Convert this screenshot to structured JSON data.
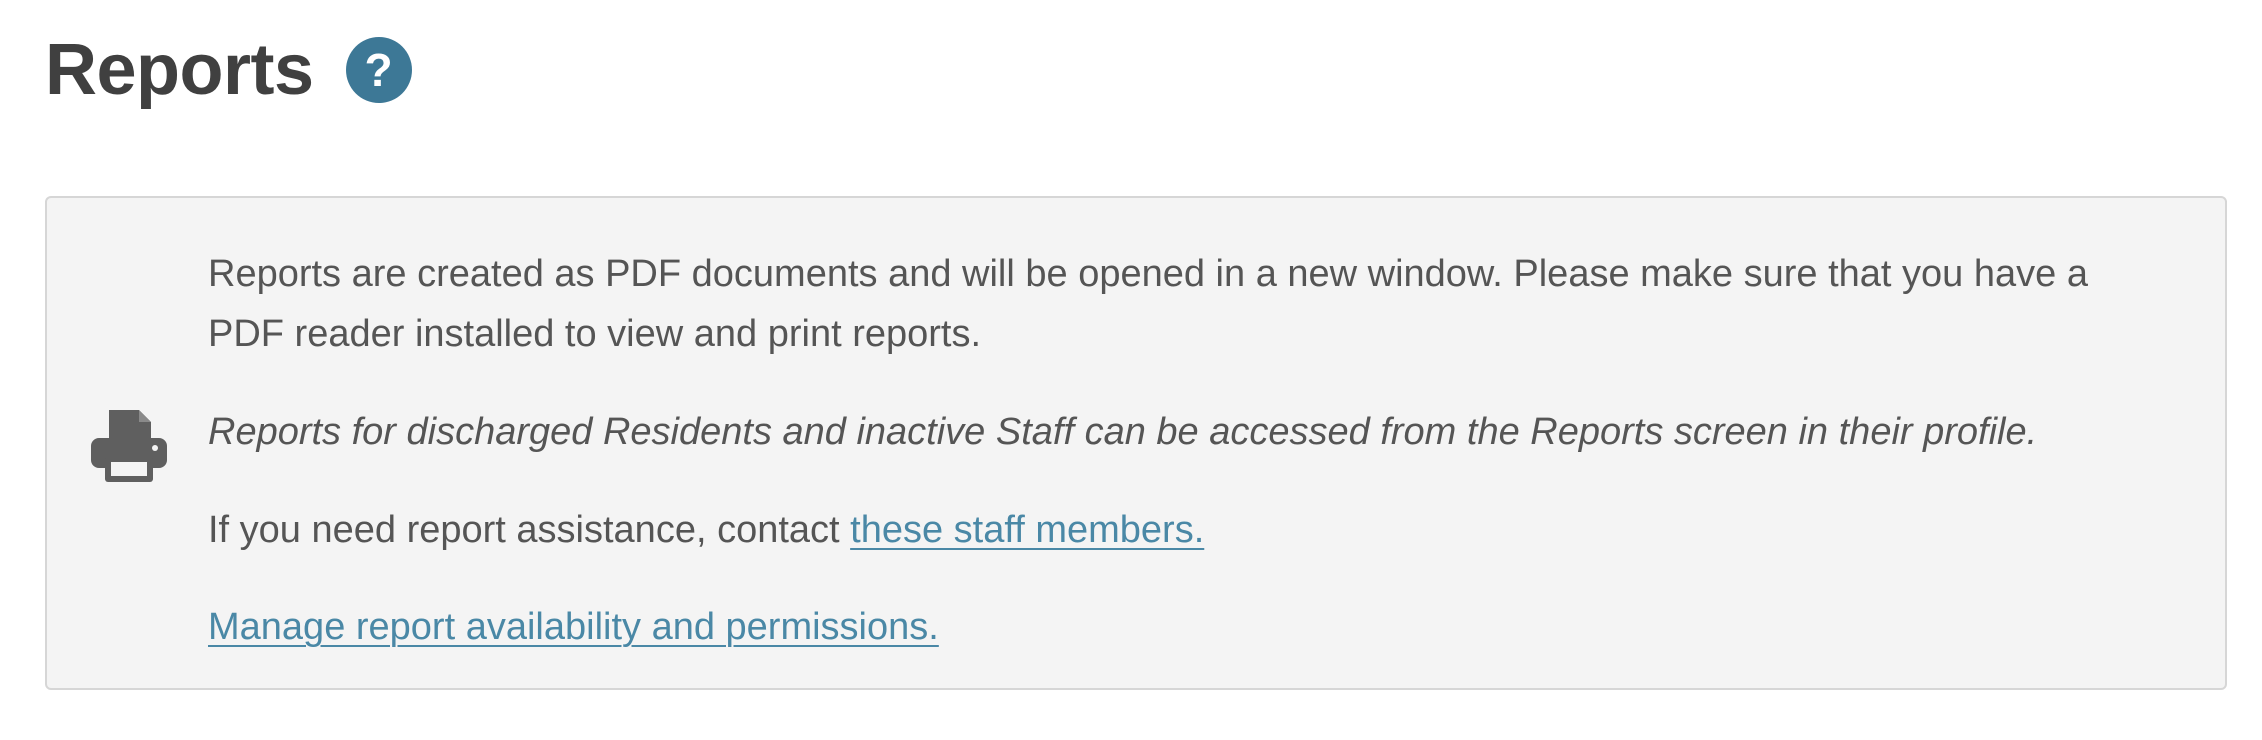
{
  "header": {
    "title": "Reports",
    "help_label": "?"
  },
  "info": {
    "icon": "printer-icon",
    "intro": "Reports are created as PDF documents and will be opened in a new window. Please make sure that you have a PDF reader installed to view and print reports.",
    "note": "Reports for discharged Residents and inactive Staff can be accessed from the Reports screen in their profile.",
    "contact_prefix": "If you need report assistance, contact ",
    "contact_link": "these staff members.",
    "manage_link": "Manage report availability and permissions."
  },
  "colors": {
    "accent": "#3d7896",
    "link": "#4a88a6",
    "panel_bg": "#f4f4f4",
    "panel_border": "#d6d6d6",
    "title": "#404040",
    "text": "#555555"
  }
}
